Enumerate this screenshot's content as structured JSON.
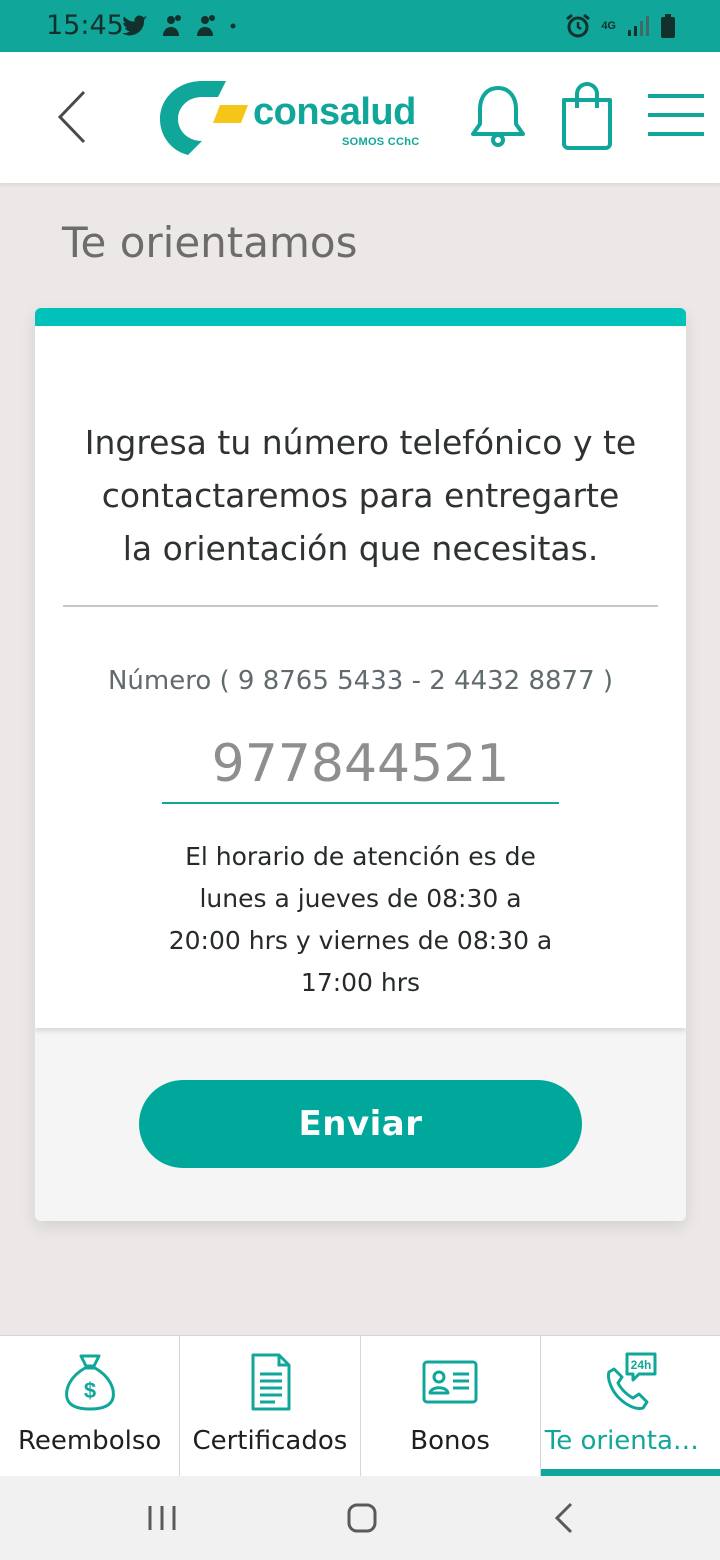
{
  "status_bar": {
    "time": "15:45",
    "network": "4G",
    "icons": [
      "twitter-icon",
      "notification-icon",
      "notification-icon",
      "dot-icon",
      "alarm-icon",
      "signal-icon",
      "battery-icon"
    ]
  },
  "header": {
    "logo_text": "consalud",
    "logo_subtext": "SOMOS CChC",
    "icons": [
      "back-icon",
      "bell-icon",
      "shopping-bag-icon",
      "menu-icon"
    ]
  },
  "page": {
    "title": "Te orientamos"
  },
  "card": {
    "intro_lines": [
      "Ingresa tu número telefónico y te",
      "contactaremos para entregarte",
      "la orientación que necesitas."
    ],
    "number_label": "Número ( 9 8765 5433 - 2 4432 8877 )",
    "number_value": "977844521",
    "hours_lines": [
      "El horario de atención es de",
      "lunes a jueves de 08:30 a",
      "20:00 hrs y viernes de 08:30 a",
      "17:00 hrs"
    ],
    "send_label": "Enviar"
  },
  "tabs": [
    {
      "label": "Reembolso",
      "icon": "money-bag-icon",
      "active": false
    },
    {
      "label": "Certificados",
      "icon": "document-icon",
      "active": false
    },
    {
      "label": "Bonos",
      "icon": "id-card-icon",
      "active": false
    },
    {
      "label": "Te orientamos",
      "icon": "phone-24h-icon",
      "active": true
    }
  ],
  "colors": {
    "brand_teal": "#10a79a",
    "accent_cyan": "#00c2bb",
    "logo_yellow": "#f5c518",
    "background": "#ece8e7"
  }
}
